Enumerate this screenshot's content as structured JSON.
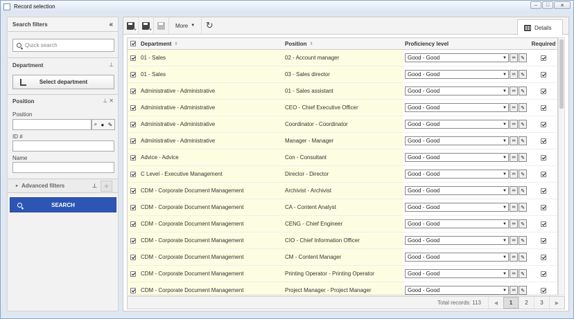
{
  "window": {
    "title": "Record selection"
  },
  "sidebar": {
    "header": "Search filters",
    "quick_search_placeholder": "Quick search",
    "department": {
      "title": "Department",
      "select_button": "Select department"
    },
    "position": {
      "title": "Position",
      "position_label": "Position",
      "id_label": "ID #",
      "name_label": "Name"
    },
    "advanced_filters": "Advanced filters",
    "search_button": "SEARCH"
  },
  "toolbar": {
    "more_label": "More",
    "details_tab": "Details"
  },
  "table": {
    "headers": {
      "department": "Department",
      "position": "Position",
      "proficiency": "Proficiency level",
      "required": "Required"
    },
    "rows": [
      {
        "department": "01 - Sales",
        "position": "02 - Account manager",
        "proficiency": "Good - Good"
      },
      {
        "department": "01 - Sales",
        "position": "03 - Sales director",
        "proficiency": "Good - Good"
      },
      {
        "department": "Administrative - Administrative",
        "position": "01 - Sales assistant",
        "proficiency": "Good - Good"
      },
      {
        "department": "Administrative - Administrative",
        "position": "CEO - Chief Executive Officer",
        "proficiency": "Good - Good"
      },
      {
        "department": "Administrative - Administrative",
        "position": "Coordinator - Coordinator",
        "proficiency": "Good - Good"
      },
      {
        "department": "Administrative - Administrative",
        "position": "Manager - Manager",
        "proficiency": "Good - Good"
      },
      {
        "department": "Advice - Advice",
        "position": "Con - Consultant",
        "proficiency": "Good - Good"
      },
      {
        "department": "C Level - Executive Management",
        "position": "Director - Director",
        "proficiency": "Good - Good"
      },
      {
        "department": "CDM - Corporate Document Management",
        "position": "Archivist - Archivist",
        "proficiency": "Good - Good"
      },
      {
        "department": "CDM - Corporate Document Management",
        "position": "CA - Content Analyst",
        "proficiency": "Good - Good"
      },
      {
        "department": "CDM - Corporate Document Management",
        "position": "CENG - Chief Engineer",
        "proficiency": "Good - Good"
      },
      {
        "department": "CDM - Corporate Document Management",
        "position": "CIO - Chief Information Officer",
        "proficiency": "Good - Good"
      },
      {
        "department": "CDM - Corporate Document Management",
        "position": "CM - Content Manager",
        "proficiency": "Good - Good"
      },
      {
        "department": "CDM - Corporate Document Management",
        "position": "Printing Operator - Printing Operator",
        "proficiency": "Good - Good"
      },
      {
        "department": "CDM - Corporate Document Management",
        "position": "Project Manager - Project Manager",
        "proficiency": "Good - Good"
      }
    ]
  },
  "footer": {
    "total_records": "Total records: 113",
    "pages": [
      "1",
      "2",
      "3"
    ]
  },
  "colors": {
    "search_button": "#2d56b4",
    "row_highlight": "#fdfde2"
  }
}
